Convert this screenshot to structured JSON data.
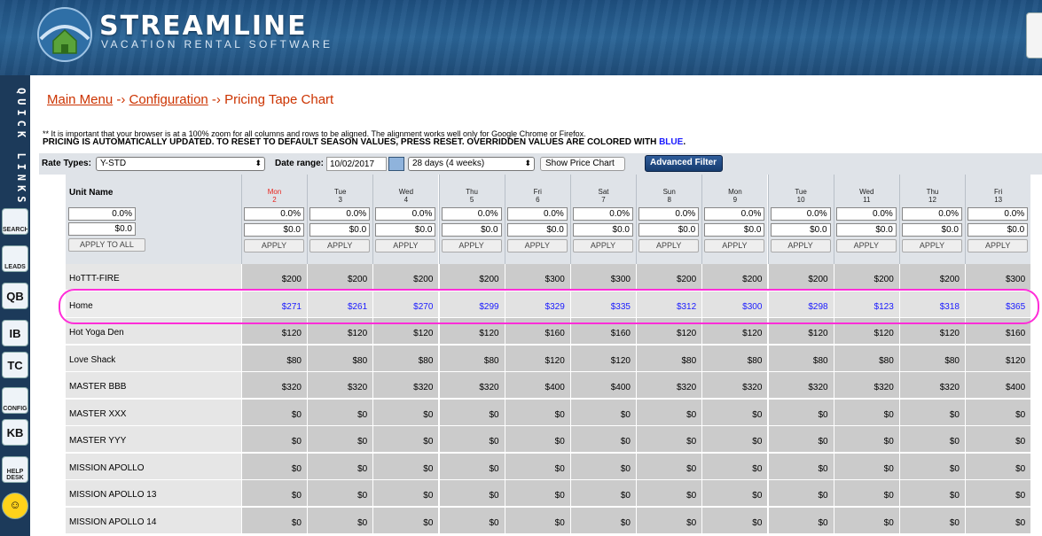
{
  "header": {
    "title": "STREAMLINE",
    "subtitle": "VACATION RENTAL SOFTWARE"
  },
  "sidebar": {
    "label": "QUICK LINKS",
    "icons": [
      {
        "name": "search-icon",
        "label": "SEARCH"
      },
      {
        "name": "leads-icon",
        "label": "LEADS"
      },
      {
        "name": "qb-icon",
        "label": "QB"
      },
      {
        "name": "ib-icon",
        "label": "IB"
      },
      {
        "name": "tc-icon",
        "label": "TC"
      },
      {
        "name": "config-icon",
        "label": "CONFIG"
      },
      {
        "name": "kb-icon",
        "label": "KB"
      },
      {
        "name": "help-desk-icon",
        "label": "HELP DESK"
      },
      {
        "name": "smiley-icon",
        "label": ""
      }
    ]
  },
  "breadcrumb": {
    "main_menu": "Main Menu",
    "sep1": " -› ",
    "configuration": "Configuration",
    "sep2": " -› ",
    "current": "Pricing Tape Chart"
  },
  "notice": {
    "line1": "** It is important that your browser is at a 100% zoom for all columns and rows to be aligned. The alignment works well only for Google Chrome or Firefox.",
    "line2": "PRICING IS AUTOMATICALLY UPDATED. TO RESET TO DEFAULT SEASON VALUES, PRESS RESET. OVERRIDDEN VALUES ARE COLORED WITH ",
    "line2_blue": "BLUE",
    "line2_end": "."
  },
  "toolbar": {
    "rate_types_label": "Rate Types:",
    "rate_types_value": "Y-STD",
    "date_range_label": "Date range:",
    "date_value": "10/02/2017",
    "range_value": "28 days (4 weeks)",
    "show_chart": "Show Price Chart",
    "advanced_filter": "Advanced Filter"
  },
  "grid": {
    "unit_name_header": "Unit Name",
    "pct_default": "0.0%",
    "amt_default": "$0.0",
    "apply_all": "APPLY TO ALL",
    "apply": "APPLY",
    "days": [
      {
        "name": "Mon",
        "num": "2",
        "today": true
      },
      {
        "name": "Tue",
        "num": "3"
      },
      {
        "name": "Wed",
        "num": "4"
      },
      {
        "name": "Thu",
        "num": "5"
      },
      {
        "name": "Fri",
        "num": "6"
      },
      {
        "name": "Sat",
        "num": "7"
      },
      {
        "name": "Sun",
        "num": "8"
      },
      {
        "name": "Mon",
        "num": "9"
      },
      {
        "name": "Tue",
        "num": "10"
      },
      {
        "name": "Wed",
        "num": "11"
      },
      {
        "name": "Thu",
        "num": "12"
      },
      {
        "name": "Fri",
        "num": "13"
      }
    ],
    "rows": [
      {
        "unit": "HoTTT-FIRE",
        "prices": [
          "$200",
          "$200",
          "$200",
          "$200",
          "$300",
          "$300",
          "$200",
          "$200",
          "$200",
          "$200",
          "$200",
          "$300"
        ]
      },
      {
        "unit": "Home",
        "overridden": true,
        "prices": [
          "$271",
          "$261",
          "$270",
          "$299",
          "$329",
          "$335",
          "$312",
          "$300",
          "$298",
          "$123",
          "$318",
          "$365"
        ]
      },
      {
        "unit": "Hot Yoga Den",
        "prices": [
          "$120",
          "$120",
          "$120",
          "$120",
          "$160",
          "$160",
          "$120",
          "$120",
          "$120",
          "$120",
          "$120",
          "$160"
        ]
      },
      {
        "unit": "Love Shack",
        "prices": [
          "$80",
          "$80",
          "$80",
          "$80",
          "$120",
          "$120",
          "$80",
          "$80",
          "$80",
          "$80",
          "$80",
          "$120"
        ]
      },
      {
        "unit": "MASTER BBB",
        "prices": [
          "$320",
          "$320",
          "$320",
          "$320",
          "$400",
          "$400",
          "$320",
          "$320",
          "$320",
          "$320",
          "$320",
          "$400"
        ]
      },
      {
        "unit": "MASTER XXX",
        "prices": [
          "$0",
          "$0",
          "$0",
          "$0",
          "$0",
          "$0",
          "$0",
          "$0",
          "$0",
          "$0",
          "$0",
          "$0"
        ]
      },
      {
        "unit": "MASTER YYY",
        "prices": [
          "$0",
          "$0",
          "$0",
          "$0",
          "$0",
          "$0",
          "$0",
          "$0",
          "$0",
          "$0",
          "$0",
          "$0"
        ]
      },
      {
        "unit": "MISSION APOLLO",
        "prices": [
          "$0",
          "$0",
          "$0",
          "$0",
          "$0",
          "$0",
          "$0",
          "$0",
          "$0",
          "$0",
          "$0",
          "$0"
        ]
      },
      {
        "unit": "MISSION APOLLO 13",
        "prices": [
          "$0",
          "$0",
          "$0",
          "$0",
          "$0",
          "$0",
          "$0",
          "$0",
          "$0",
          "$0",
          "$0",
          "$0"
        ]
      },
      {
        "unit": "MISSION APOLLO 14",
        "prices": [
          "$0",
          "$0",
          "$0",
          "$0",
          "$0",
          "$0",
          "$0",
          "$0",
          "$0",
          "$0",
          "$0",
          "$0"
        ]
      }
    ]
  },
  "colors": {
    "overridden": "#1a1aff",
    "today": "#e8231c",
    "highlight": "#ff2dd8"
  }
}
